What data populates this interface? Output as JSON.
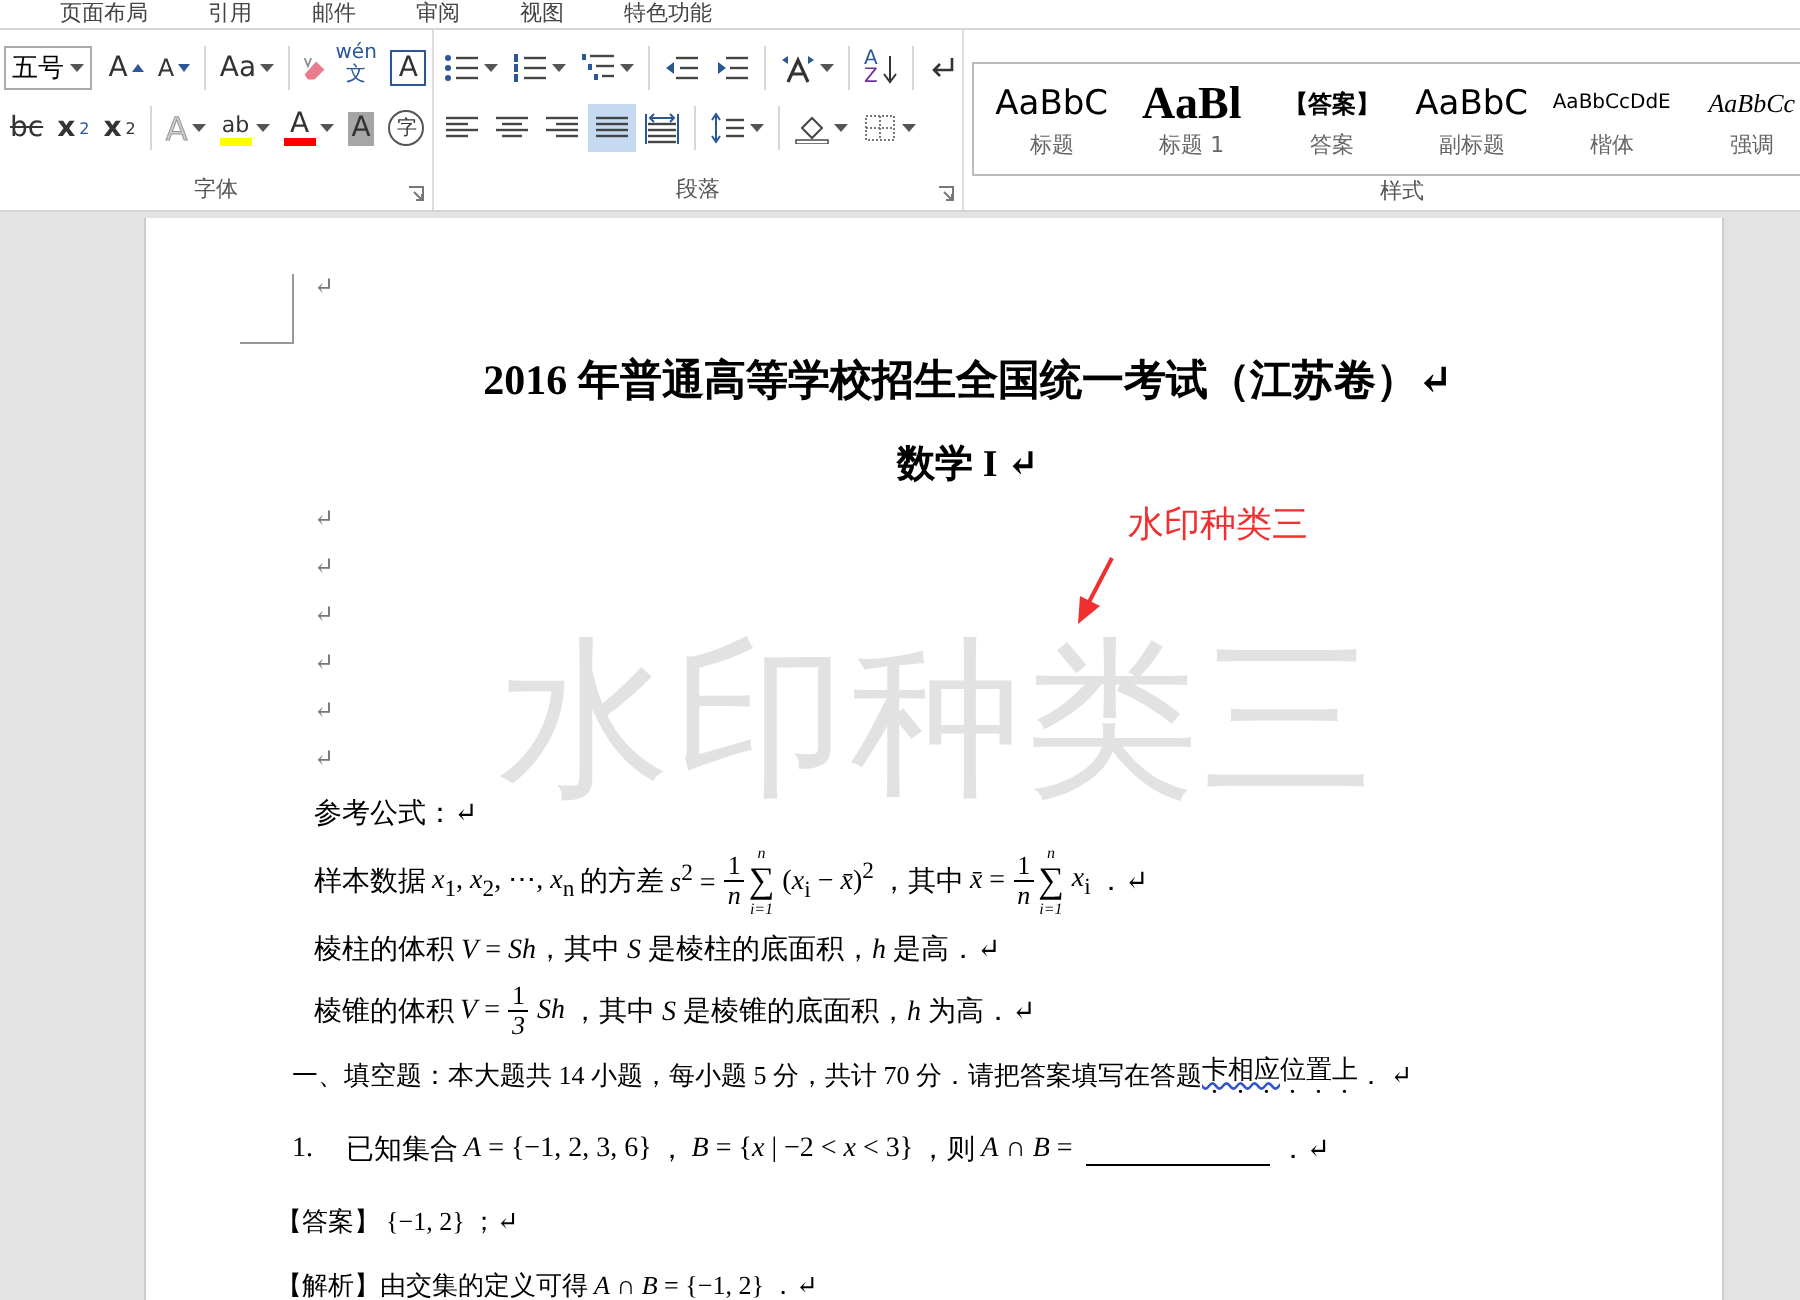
{
  "ribbon_tabs": [
    {
      "label": "页面布局"
    },
    {
      "label": "引用"
    },
    {
      "label": "邮件"
    },
    {
      "label": "审阅"
    },
    {
      "label": "视图"
    },
    {
      "label": "特色功能"
    }
  ],
  "font_group": {
    "label": "字体",
    "upper": [
      {
        "kind": "size-dropdown",
        "text": "五号"
      },
      {
        "kind": "grow-font",
        "text": "A"
      },
      {
        "kind": "shrink-font",
        "text": "A"
      },
      {
        "kind": "sep"
      },
      {
        "kind": "change-case",
        "text": "Aa"
      },
      {
        "kind": "sep"
      },
      {
        "kind": "clear-format"
      },
      {
        "kind": "phonetic",
        "text": "wén",
        "sub": "文"
      },
      {
        "kind": "char-border",
        "text": "A"
      }
    ],
    "lower": [
      {
        "kind": "strike",
        "text": "bc"
      },
      {
        "kind": "subscript",
        "text": "x",
        "sub": "2"
      },
      {
        "kind": "superscript",
        "text": "x",
        "sub": "2"
      },
      {
        "kind": "sep"
      },
      {
        "kind": "text-effect",
        "text": "A"
      },
      {
        "kind": "highlight",
        "text": "ab",
        "color": "#ffff00"
      },
      {
        "kind": "font-color",
        "text": "A",
        "color": "#ff0000"
      },
      {
        "kind": "char-shading",
        "text": "A"
      },
      {
        "kind": "enclose",
        "text": "字"
      }
    ]
  },
  "paragraph_group": {
    "label": "段落",
    "upper": [
      {
        "kind": "bullets"
      },
      {
        "kind": "numbering"
      },
      {
        "kind": "multilevel"
      },
      {
        "kind": "sep"
      },
      {
        "kind": "outdent"
      },
      {
        "kind": "indent"
      },
      {
        "kind": "sep"
      },
      {
        "kind": "asian-layout"
      },
      {
        "kind": "sep"
      },
      {
        "kind": "sort",
        "text": "A",
        "sub": "Z"
      },
      {
        "kind": "sep"
      },
      {
        "kind": "show-marks"
      }
    ],
    "lower": [
      {
        "kind": "align-left",
        "selected": false
      },
      {
        "kind": "align-center",
        "selected": false
      },
      {
        "kind": "align-right",
        "selected": false
      },
      {
        "kind": "justify",
        "selected": true
      },
      {
        "kind": "distribute",
        "selected": false
      },
      {
        "kind": "sep"
      },
      {
        "kind": "line-spacing"
      },
      {
        "kind": "sep"
      },
      {
        "kind": "shading"
      },
      {
        "kind": "borders"
      }
    ]
  },
  "styles_group": {
    "label": "样式",
    "styles": [
      {
        "kind": "title",
        "preview": "AaBbC",
        "label": "标题"
      },
      {
        "kind": "heading1",
        "preview": "AaBl",
        "label": "标题 1"
      },
      {
        "kind": "answer",
        "preview": "【答案】",
        "label": "答案"
      },
      {
        "kind": "subtitle",
        "preview": "AaBbC",
        "label": "副标题"
      },
      {
        "kind": "kaiti",
        "preview": "AaBbCcDdE",
        "label": "楷体"
      },
      {
        "kind": "emphasis",
        "preview": "AaBbCc",
        "label": "强调"
      }
    ]
  },
  "document": {
    "watermark": "水印种类三",
    "paragraphs": [
      {
        "kind": "empty",
        "segments": [
          {
            "kind": "text",
            "text": "↵"
          }
        ]
      },
      {
        "kind": "title",
        "segments": [
          {
            "kind": "text",
            "text": "2016 年普通高等学校招生全国统一考试（江苏卷）↵"
          }
        ]
      },
      {
        "kind": "subtitle",
        "segments": [
          {
            "kind": "text",
            "text": "数学 I ↵"
          }
        ]
      },
      {
        "kind": "empty",
        "segments": [
          {
            "kind": "text",
            "text": "↵"
          }
        ]
      },
      {
        "kind": "empty",
        "segments": [
          {
            "kind": "text",
            "text": "↵"
          }
        ]
      },
      {
        "kind": "empty",
        "segments": [
          {
            "kind": "text",
            "text": "↵"
          }
        ]
      },
      {
        "kind": "empty",
        "segments": [
          {
            "kind": "text",
            "text": "↵"
          }
        ]
      },
      {
        "kind": "empty",
        "segments": [
          {
            "kind": "text",
            "text": "↵"
          }
        ]
      },
      {
        "kind": "empty",
        "segments": [
          {
            "kind": "text",
            "text": "↵"
          }
        ]
      },
      {
        "kind": "body",
        "segments": [
          {
            "kind": "text",
            "text": "参考公式：↵"
          }
        ]
      },
      {
        "kind": "body",
        "segments": [
          {
            "kind": "text",
            "text": "样本数据"
          },
          {
            "kind": "math",
            "text": "*x*$_{1}$, *x*$_{2}$, ⋯, *x*$_{n}$"
          },
          {
            "kind": "text",
            "text": "的方差"
          },
          {
            "kind": "math",
            "text": "*s*$^{2}$ ="
          },
          {
            "kind": "frac",
            "num": "1",
            "den": "n"
          },
          {
            "kind": "sum",
            "top": "n",
            "symbol": "∑",
            "bottom": "i=1"
          },
          {
            "kind": "math",
            "text": "(*x*$_{i}$ − *x̄*)$^{2}$"
          },
          {
            "kind": "text",
            "text": "，其中"
          },
          {
            "kind": "math",
            "text": "*x̄* ="
          },
          {
            "kind": "frac",
            "num": "1",
            "den": "n"
          },
          {
            "kind": "sum",
            "top": "n",
            "symbol": "∑",
            "bottom": "i=1"
          },
          {
            "kind": "math",
            "text": "*x*$_{i}$"
          },
          {
            "kind": "text",
            "text": " ．↵"
          }
        ]
      },
      {
        "kind": "body",
        "segments": [
          {
            "kind": "text",
            "text": "棱柱的体积 *V* = *Sh*，其中 *S* 是棱柱的底面积，*h* 是高．↵"
          }
        ]
      },
      {
        "kind": "body",
        "segments": [
          {
            "kind": "text",
            "text": "棱锥的体积"
          },
          {
            "kind": "math",
            "text": "*V* ="
          },
          {
            "kind": "frac",
            "num": "1",
            "den": "3"
          },
          {
            "kind": "math",
            "text": "*Sh*"
          },
          {
            "kind": "text",
            "text": "，其中 *S* 是棱锥的底面积，*h* 为高．↵"
          }
        ]
      },
      {
        "kind": "section",
        "segments": [
          {
            "kind": "text",
            "text": "一、填空题：本大题共 14 小题，每小题 5 分，共计 70 分．请把答案填写在答题"
          },
          {
            "kind": "emph-flagged",
            "text": "卡相应"
          },
          {
            "kind": "emph",
            "text": "位置上"
          },
          {
            "kind": "text",
            "text": "． ↵"
          }
        ]
      },
      {
        "kind": "question",
        "number": "1.",
        "segments": [
          {
            "kind": "text",
            "text": "已知集合"
          },
          {
            "kind": "math",
            "text": "*A* = {−1, 2, 3, 6}"
          },
          {
            "kind": "text",
            "text": "，"
          },
          {
            "kind": "math",
            "text": "*B* = {*x* | −2 < *x* < 3}"
          },
          {
            "kind": "text",
            "text": "，则"
          },
          {
            "kind": "math",
            "text": "*A* ∩ *B* ="
          },
          {
            "kind": "blank"
          },
          {
            "kind": "text",
            "text": "．↵"
          }
        ]
      },
      {
        "kind": "answer",
        "segments": [
          {
            "kind": "text",
            "text": "【答案】"
          },
          {
            "kind": "math",
            "text": "{−1, 2}"
          },
          {
            "kind": "text",
            "text": "；↵"
          }
        ]
      },
      {
        "kind": "analysis",
        "segments": [
          {
            "kind": "text",
            "text": "【解析】由交集的定义可得"
          },
          {
            "kind": "math",
            "text": "*A* ∩ *B* = {−1, 2}"
          },
          {
            "kind": "text",
            "text": "．↵"
          }
        ]
      }
    ]
  },
  "annotation": {
    "text": "水印种类三"
  }
}
